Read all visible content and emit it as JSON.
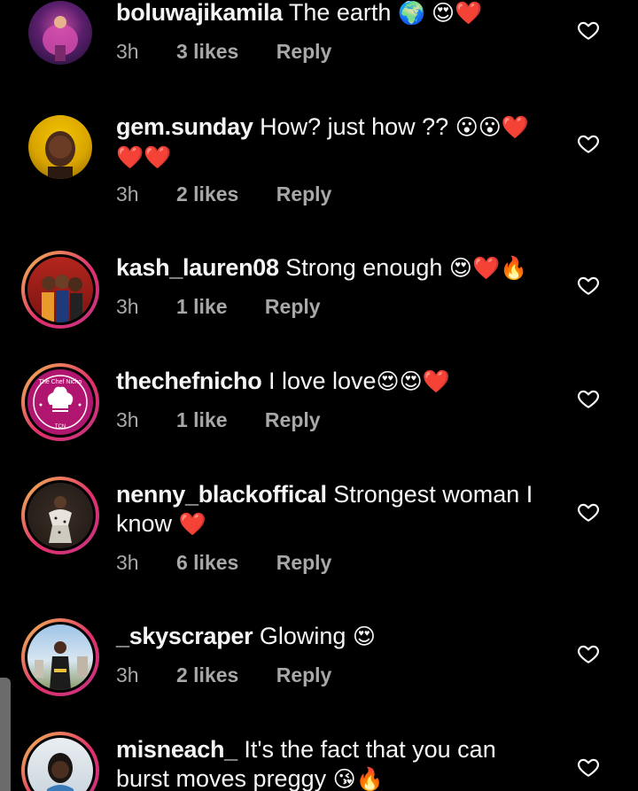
{
  "comments": [
    {
      "username": "boluwajikamila",
      "text": "The earth",
      "emoji": "🌍 😍❤️",
      "time": "3h",
      "likes": "3 likes",
      "reply": "Reply",
      "story_ring": false
    },
    {
      "username": "gem.sunday",
      "text": "How? just how ??",
      "emoji": "😮😮❤️",
      "line2": "❤️❤️",
      "time": "3h",
      "likes": "2 likes",
      "reply": "Reply",
      "story_ring": false
    },
    {
      "username": "kash_lauren08",
      "text": "Strong enough",
      "emoji": "😍❤️🔥",
      "time": "3h",
      "likes": "1 like",
      "reply": "Reply",
      "story_ring": true
    },
    {
      "username": "thechefnicho",
      "text": "I love love",
      "emoji": "😍😍❤️",
      "time": "3h",
      "likes": "1 like",
      "reply": "Reply",
      "story_ring": true,
      "logo_top": "The Chef Nicho",
      "logo_bottom": "TCN"
    },
    {
      "username": "nenny_blackoffical",
      "text": "Strongest woman I",
      "line2": "know",
      "emoji": "❤️",
      "time": "3h",
      "likes": "6 likes",
      "reply": "Reply",
      "story_ring": true
    },
    {
      "username": "_skyscraper",
      "text": "Glowing",
      "emoji": "😍",
      "time": "3h",
      "likes": "2 likes",
      "reply": "Reply",
      "story_ring": true
    },
    {
      "username": "misneach_",
      "text": "It's the fact that you can",
      "line2": "burst moves preggy",
      "emoji": "😘🔥",
      "story_ring": true
    }
  ],
  "icons": {
    "like": "heart-outline-icon"
  },
  "colors": {
    "background": "#000000",
    "text": "#f5f5f5",
    "meta": "#a8a8a8",
    "ring_start": "#f2c14e",
    "ring_end": "#c13584"
  }
}
